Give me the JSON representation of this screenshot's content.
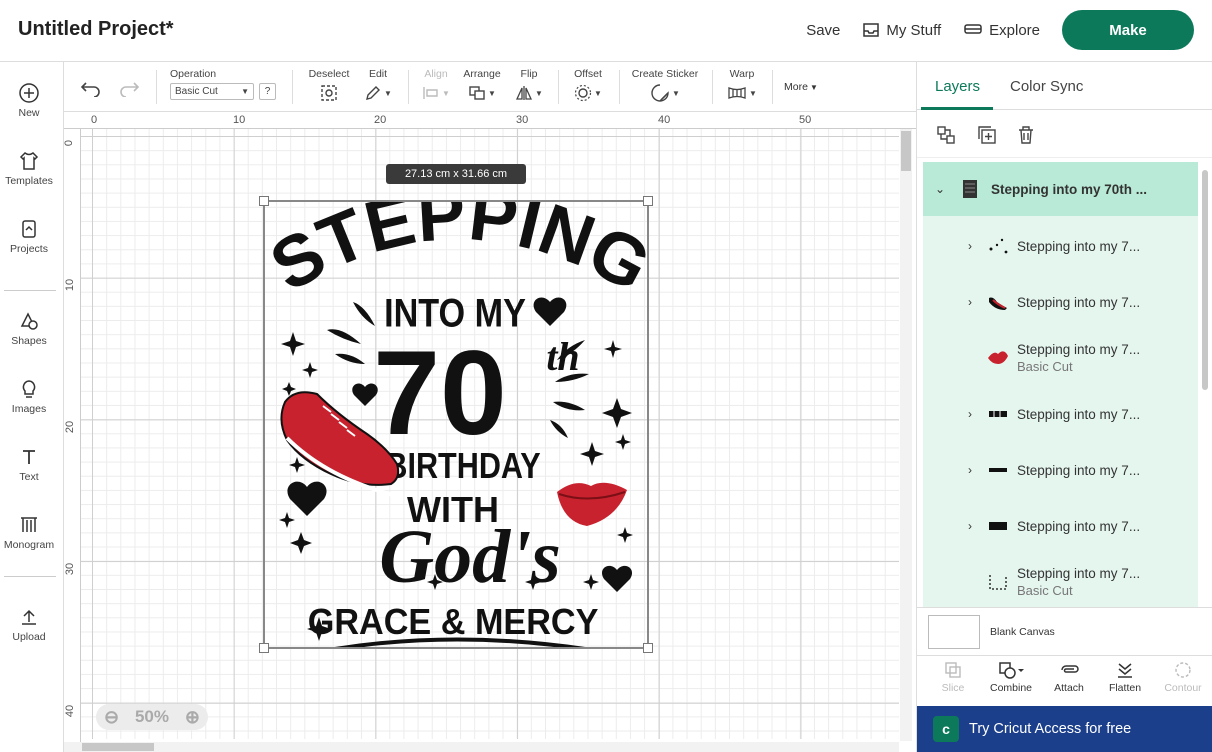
{
  "header": {
    "project_title": "Untitled Project*",
    "save_label": "Save",
    "my_stuff_label": "My Stuff",
    "explore_label": "Explore",
    "make_label": "Make"
  },
  "sidebar": {
    "items": [
      {
        "label": "New",
        "icon": "plus-circle-icon"
      },
      {
        "label": "Templates",
        "icon": "shirt-icon"
      },
      {
        "label": "Projects",
        "icon": "projects-icon"
      },
      {
        "label": "Shapes",
        "icon": "shapes-icon"
      },
      {
        "label": "Images",
        "icon": "lightbulb-icon"
      },
      {
        "label": "Text",
        "icon": "text-icon"
      },
      {
        "label": "Monogram",
        "icon": "monogram-icon"
      },
      {
        "label": "Upload",
        "icon": "upload-icon"
      }
    ]
  },
  "toolbar": {
    "operation_label": "Operation",
    "operation_value": "Basic Cut",
    "help_label": "?",
    "deselect_label": "Deselect",
    "edit_label": "Edit",
    "align_label": "Align",
    "arrange_label": "Arrange",
    "flip_label": "Flip",
    "offset_label": "Offset",
    "create_sticker_label": "Create Sticker",
    "warp_label": "Warp",
    "more_label": "More"
  },
  "canvas": {
    "ruler_top": [
      "0",
      "10",
      "20",
      "30",
      "40",
      "50"
    ],
    "ruler_left": [
      "0",
      "10",
      "20",
      "30",
      "40"
    ],
    "dimensions": "27.13  cm x 31.66  cm",
    "zoom_value": "50%"
  },
  "design_text": {
    "line1": "STEPPING",
    "line2": "INTO MY",
    "line3": "70",
    "line3_sup": "th",
    "line4": "BIRTHDAY",
    "line5": "WITH",
    "line6": "God's",
    "line7": "GRACE & MERCY"
  },
  "panel": {
    "tab_layers": "Layers",
    "tab_color_sync": "Color Sync",
    "group_name": "Stepping into my 70th ...",
    "layers": [
      {
        "name": "Stepping into my 7...",
        "sub": "",
        "expandable": true
      },
      {
        "name": "Stepping into my 7...",
        "sub": "",
        "expandable": true
      },
      {
        "name": "Stepping into my 7...",
        "sub": "Basic Cut",
        "expandable": false
      },
      {
        "name": "Stepping into my 7...",
        "sub": "",
        "expandable": true
      },
      {
        "name": "Stepping into my 7...",
        "sub": "",
        "expandable": true
      },
      {
        "name": "Stepping into my 7...",
        "sub": "",
        "expandable": true
      },
      {
        "name": "Stepping into my 7...",
        "sub": "Basic Cut",
        "expandable": false
      }
    ],
    "blank_canvas_label": "Blank Canvas",
    "bottom_tools": {
      "slice": "Slice",
      "combine": "Combine",
      "attach": "Attach",
      "flatten": "Flatten",
      "contour": "Contour"
    },
    "promo": "Try Cricut Access for free"
  },
  "colors": {
    "accent": "#0c7a5a",
    "layer_selected": "#b9ead7",
    "layer_bg": "#e5f6ef",
    "promo_bg": "#1b3f8b",
    "design_red": "#c8222e"
  }
}
